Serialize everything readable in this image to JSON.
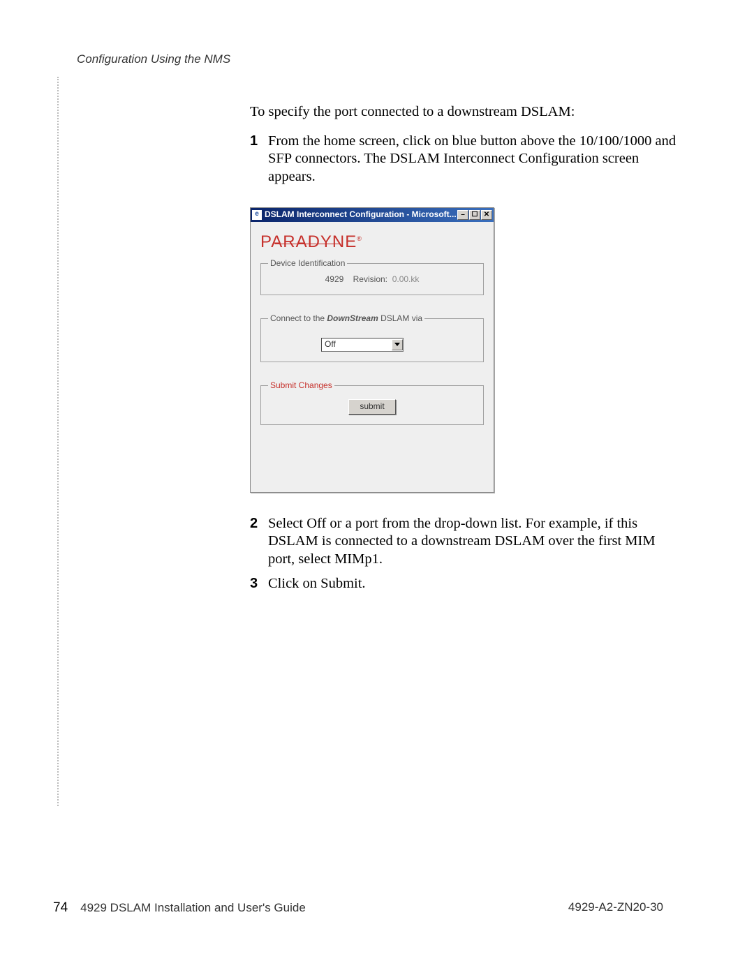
{
  "header": "Configuration Using the NMS",
  "content": {
    "intro": "To specify the port connected to a downstream DSLAM:",
    "step1": "From the home screen, click on blue button above the 10/100/1000 and SFP connectors. The DSLAM Interconnect Configuration screen appears.",
    "step2": "Select Off or a port from the drop-down list. For example, if this DSLAM is connected to a downstream DSLAM over the first MIM port, select MIMp1.",
    "step3": "Click on Submit.",
    "num1": "1",
    "num2": "2",
    "num3": "3"
  },
  "window": {
    "title": "DSLAM Interconnect Configuration - Microsoft...",
    "brand": "PARADYNE",
    "brand_reg": "®",
    "group1_legend": "Device Identification",
    "device_id": "4929",
    "revision_label": "Revision:",
    "revision_value": "0.00.kk",
    "group2_legend_pre": "Connect to the ",
    "group2_legend_em": "DownStream",
    "group2_legend_post": " DSLAM via",
    "select_value": "Off",
    "group3_legend": "Submit Changes",
    "submit_label": "submit",
    "min_glyph": "–",
    "max_glyph": "☐",
    "close_glyph": "✕",
    "icon_glyph": "e"
  },
  "footer": {
    "page_num": "74",
    "doc_title": "4929 DSLAM Installation and User's Guide",
    "doc_code": "4929-A2-ZN20-30"
  }
}
